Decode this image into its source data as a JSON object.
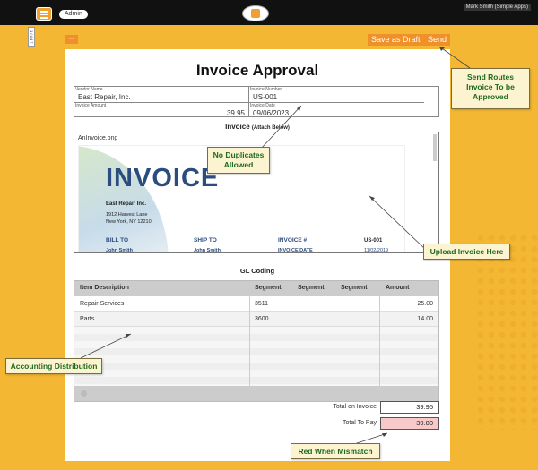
{
  "topbar": {
    "role_label": "Admin",
    "user_label": "Mark Smith (Simple Apps)"
  },
  "side_tab": {
    "label": "1 / 4 4 7"
  },
  "toolbar": {
    "more_label": "...",
    "save_draft_label": "Save as Draft",
    "send_label": "Send"
  },
  "form": {
    "title": "Invoice Approval",
    "fields": {
      "vendor_name_label": "Vendor Name",
      "vendor_name_value": "East Repair, Inc.",
      "invoice_number_label": "Invoice Number",
      "invoice_number_value": "US-001",
      "invoice_amount_label": "Invoice Amount",
      "invoice_amount_value": "39.95",
      "invoice_date_label": "Invoice Date",
      "invoice_date_value": "09/06/2023"
    },
    "attachment": {
      "caption": "Invoice",
      "caption_suffix": "(Attach Below)",
      "file_name": "AnInvoice.png",
      "preview": {
        "heading": "INVOICE",
        "company": "East Repair Inc.",
        "address_line1": "1912 Harvest Lane",
        "address_line2": "New York, NY 12210",
        "bill_to": "BILL TO",
        "ship_to": "SHIP TO",
        "invoice_hash": "INVOICE #",
        "invoice_number": "US-001",
        "name1": "John Smith",
        "name2": "John Smith",
        "invoice_date": "INVOICE DATE",
        "date_value": "11/02/2019"
      }
    },
    "gl_coding": {
      "caption": "GL Coding",
      "columns": [
        "Item Description",
        "Segment",
        "Segment",
        "Segment",
        "Amount"
      ],
      "rows": [
        {
          "description": "Repair Services",
          "segment1": "3511",
          "amount": "25.00"
        },
        {
          "description": "Parts",
          "segment1": "3600",
          "amount": "14.00"
        }
      ]
    },
    "totals": {
      "total_on_invoice_label": "Total on Invoice",
      "total_on_invoice_value": "39.95",
      "total_to_pay_label": "Total To Pay",
      "total_to_pay_value": "39.00"
    }
  },
  "callouts": {
    "send": "Send Routes Invoice To be Approved",
    "no_duplicates": "No Duplicates Allowed",
    "upload": "Upload Invoice Here",
    "accounting": "Accounting Distribution",
    "red_mismatch": "Red When Mismatch"
  },
  "colors": {
    "background": "#f4b733",
    "button": "#f0902a",
    "mismatch": "#f8c9c9",
    "callout_text": "#1d6b1d"
  }
}
